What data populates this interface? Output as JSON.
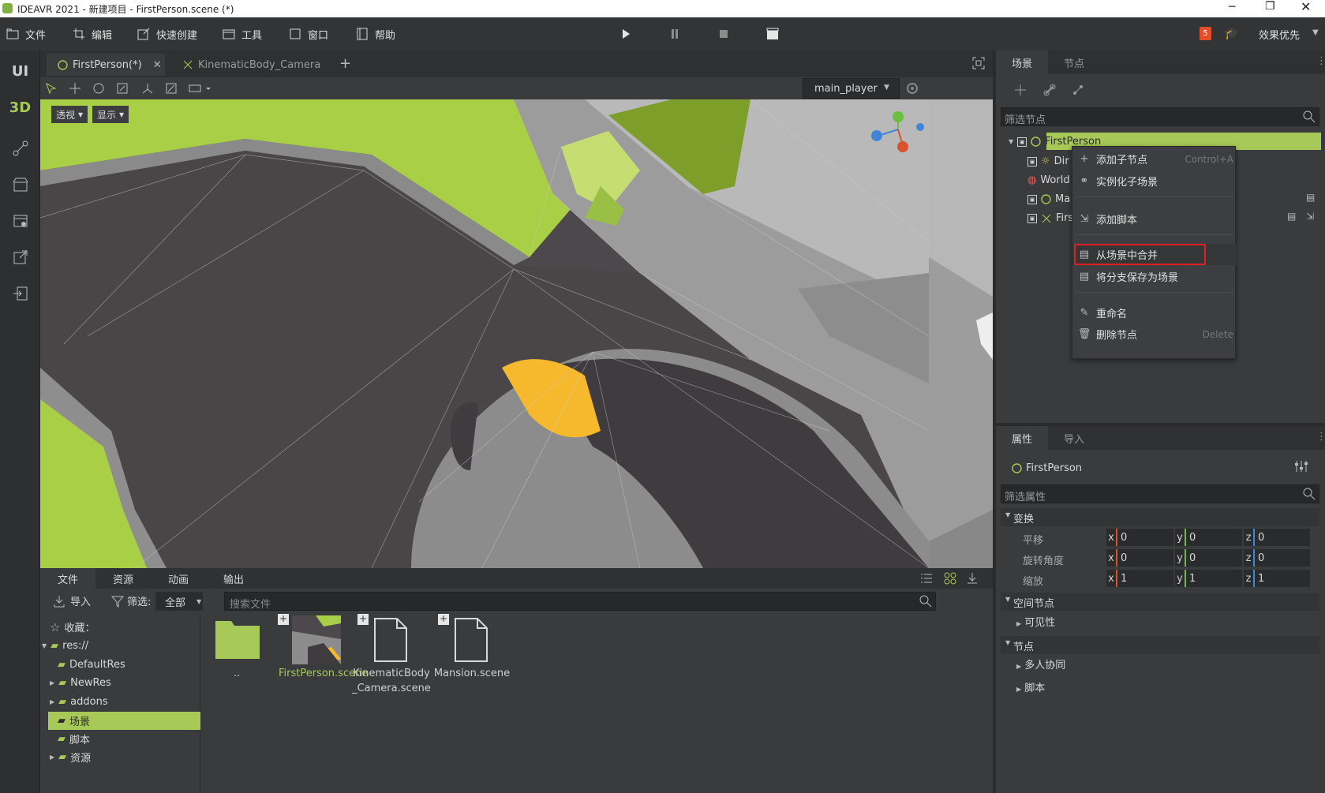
{
  "window": {
    "title": "IDEAVR 2021 - 新建项目 - FirstPerson.scene (*)"
  },
  "menu": {
    "file": "文件",
    "edit": "编辑",
    "quick_create": "快速创建",
    "tools": "工具",
    "window": "窗口",
    "help": "帮助",
    "quality": "效果优先"
  },
  "leftbar": {
    "ui": "UI",
    "threed": "3D"
  },
  "tabs": [
    {
      "label": "FirstPerson(*)"
    },
    {
      "label": "KinematicBody_Camera"
    }
  ],
  "viewport": {
    "camera_select": "main_player",
    "perspective": "透视",
    "display": "显示"
  },
  "bottom": {
    "tabs": [
      "文件",
      "资源",
      "动画",
      "输出"
    ],
    "import": "导入",
    "filter": "筛选:",
    "filter_value": "全部",
    "search_placeholder": "搜索文件",
    "favorites": "收藏：",
    "tree": [
      "res://",
      "DefaultRes",
      "NewRes",
      "addons",
      "场景",
      "脚本",
      "资源"
    ],
    "files": [
      {
        "name": ".."
      },
      {
        "name": "FirstPerson.scene"
      },
      {
        "name": "KinematicBody_Camera.scene"
      },
      {
        "name": "Mansion.scene"
      }
    ]
  },
  "scene_panel": {
    "tabs": [
      "场景",
      "节点"
    ],
    "filter_placeholder": "筛选节点",
    "root": "FirstPerson",
    "children": [
      "Dir",
      "World",
      "Ma",
      "Firs"
    ]
  },
  "context_menu": {
    "items": [
      {
        "label": "添加子节点",
        "shortcut": "Control+A"
      },
      {
        "label": "实例化子场景",
        "shortcut": ""
      },
      {
        "label": "添加脚本",
        "shortcut": ""
      },
      {
        "label": "从场景中合并",
        "shortcut": ""
      },
      {
        "label": "将分支保存为场景",
        "shortcut": ""
      },
      {
        "label": "重命名",
        "shortcut": ""
      },
      {
        "label": "删除节点",
        "shortcut": "Delete"
      }
    ],
    "highlighted": "从场景中合并"
  },
  "properties": {
    "tabs": [
      "属性",
      "导入"
    ],
    "node": "FirstPerson",
    "filter_placeholder": "筛选属性",
    "transform_section": "变换",
    "rows": [
      {
        "label": "平移",
        "x": "0",
        "y": "0",
        "z": "0"
      },
      {
        "label": "旋转角度",
        "x": "0",
        "y": "0",
        "z": "0"
      },
      {
        "label": "缩放",
        "x": "1",
        "y": "1",
        "z": "1"
      }
    ],
    "axis_x": "x",
    "axis_y": "y",
    "axis_z": "z",
    "spatial_section": "空间节点",
    "visibility": "可见性",
    "node_section": "节点",
    "multiplayer": "多人协同",
    "script": "脚本"
  },
  "colors": {
    "accent": "#a7c957",
    "highlight_border": "#e02020",
    "axis_x": "#d9532b",
    "axis_y": "#6abf3c",
    "axis_z": "#3f86d6"
  }
}
